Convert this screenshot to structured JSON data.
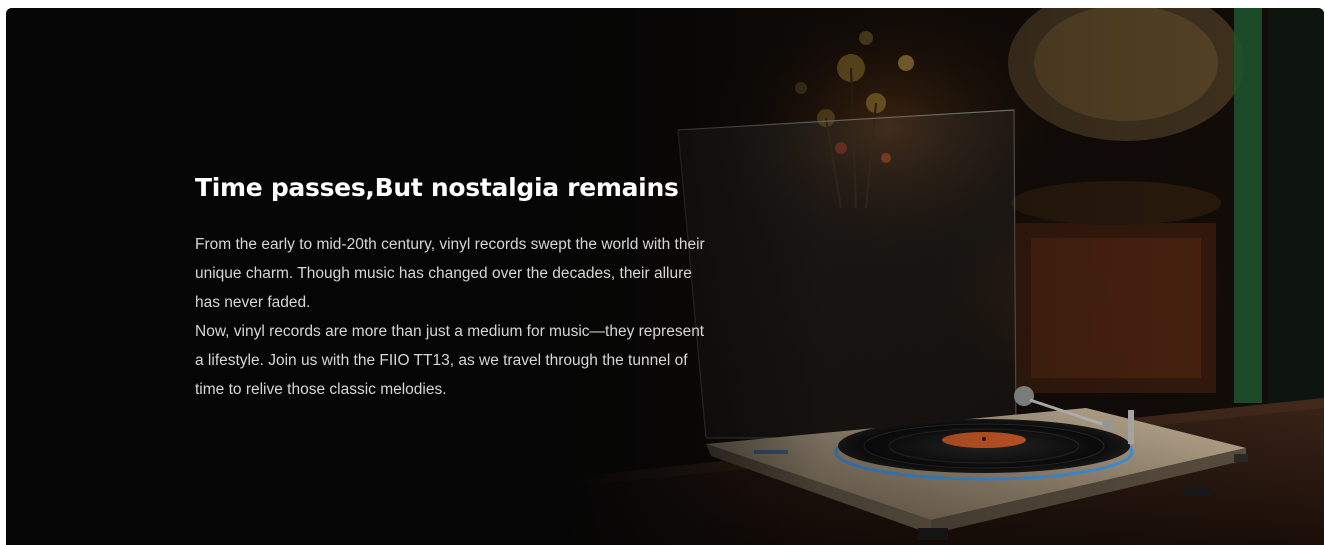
{
  "hero": {
    "title": "Time passes,But nostalgia remains",
    "paragraph_1": "From the early to mid-20th century, vinyl records swept the world with their unique charm. Though music has changed over the decades, their allure has never faded.",
    "paragraph_2": "Now, vinyl records are more than just a medium for music—they represent a lifestyle. Join us with the FIIO TT13, as we travel through the tunnel of time to relive those classic melodies."
  },
  "colors": {
    "background": "#050505",
    "title": "#ffffff",
    "body": "#d6d6d6",
    "label_orange": "#e0622a",
    "platter_glow": "#3aa0ff"
  },
  "imagery": {
    "turntable_icon": "turntable-illustration",
    "gramophone_icon": "gramophone-illustration",
    "plant_icon": "dried-flowers-illustration"
  }
}
